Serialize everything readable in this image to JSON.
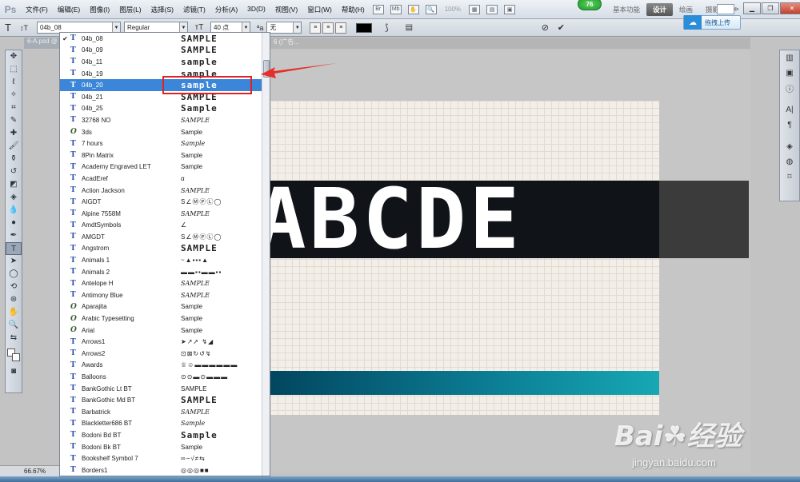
{
  "app": {
    "logo": "Ps",
    "menu": [
      "文件(F)",
      "编辑(E)",
      "图像(I)",
      "图层(L)",
      "选择(S)",
      "滤镜(T)",
      "分析(A)",
      "3D(D)",
      "视图(V)",
      "窗口(W)",
      "帮助(H)"
    ],
    "zoom_display": "100%",
    "badge": "76",
    "workspaces": [
      "基本功能",
      "设计",
      "绘画",
      "摄影"
    ],
    "workspace_more": "≫"
  },
  "options": {
    "font_family": "04b_08",
    "font_style": "Regular",
    "font_size": "40 点",
    "aa_label": "ªa",
    "aa_value": "无",
    "upload_button": "拖拽上传"
  },
  "document": {
    "tab_left": "6-A.psd @",
    "tab_right": "6 (广告...",
    "canvas_text": "ABCDE",
    "zoom_status": "66.67%"
  },
  "font_list": [
    {
      "name": "04b_08",
      "sample": "SAMPLE",
      "type": "tt",
      "checked": true,
      "style": "bold"
    },
    {
      "name": "04b_09",
      "sample": "SAMPLE",
      "type": "tt",
      "style": "bold"
    },
    {
      "name": "04b_11",
      "sample": "sample",
      "type": "tt",
      "style": "bold"
    },
    {
      "name": "04b_19",
      "sample": "sample",
      "type": "tt",
      "style": "bold"
    },
    {
      "name": "04b_20",
      "sample": "sample",
      "type": "tt",
      "selected": true,
      "style": "bold"
    },
    {
      "name": "04b_21",
      "sample": "SAMPLE",
      "type": "tt",
      "style": "bold"
    },
    {
      "name": "04b_25",
      "sample": "Sample",
      "type": "tt",
      "style": "bold"
    },
    {
      "name": "32768 NO",
      "sample": "SAMPLE",
      "type": "tt",
      "style": "script"
    },
    {
      "name": "3ds",
      "sample": "Sample",
      "type": "otf"
    },
    {
      "name": "7 hours",
      "sample": "Sample",
      "type": "tt",
      "style": "script"
    },
    {
      "name": "8Pin Matrix",
      "sample": "Sample",
      "type": "tt"
    },
    {
      "name": "Academy Engraved LET",
      "sample": "Sample",
      "type": "tt"
    },
    {
      "name": "AcadEref",
      "sample": "α",
      "type": "tt"
    },
    {
      "name": "Action Jackson",
      "sample": "SAMPLE",
      "type": "tt",
      "style": "script"
    },
    {
      "name": "AIGDT",
      "sample": "S∠ⓂⓅⓁ◯",
      "type": "tt",
      "style": "sym"
    },
    {
      "name": "Alpine 7558M",
      "sample": "SAMPLE",
      "type": "tt",
      "style": "script"
    },
    {
      "name": "AmdtSymbols",
      "sample": "∠",
      "type": "tt",
      "style": "sym"
    },
    {
      "name": "AMGDT",
      "sample": "S∠ⓂⓅⓁ◯",
      "type": "tt",
      "style": "sym"
    },
    {
      "name": "Angstrom",
      "sample": "SAMPLE",
      "type": "tt",
      "style": "bold"
    },
    {
      "name": "Animals 1",
      "sample": "~▲▪▪▪▲",
      "type": "tt",
      "style": "sym"
    },
    {
      "name": "Animals 2",
      "sample": "▬▬▪▪▬▬▪▪",
      "type": "tt",
      "style": "sym"
    },
    {
      "name": "Antelope H",
      "sample": "SAMPLE",
      "type": "tt",
      "style": "script"
    },
    {
      "name": "Antimony Blue",
      "sample": "SAMPLE",
      "type": "tt",
      "style": "script"
    },
    {
      "name": "Aparajita",
      "sample": "Sample",
      "type": "otf"
    },
    {
      "name": "Arabic Typesetting",
      "sample": "Sample",
      "type": "otf"
    },
    {
      "name": "Arial",
      "sample": "Sample",
      "type": "otf"
    },
    {
      "name": "Arrows1",
      "sample": "➤↗➚ ↯◢",
      "type": "tt",
      "style": "sym"
    },
    {
      "name": "Arrows2",
      "sample": "⊡⊠↻↺↯",
      "type": "tt",
      "style": "sym"
    },
    {
      "name": "Awards",
      "sample": "♕☺▬▬▬▬▬▬",
      "type": "tt",
      "style": "sym"
    },
    {
      "name": "Balloons",
      "sample": "⊙⊙▬⊙▬▬▬",
      "type": "tt",
      "style": "sym"
    },
    {
      "name": "BankGothic Lt BT",
      "sample": "SAMPLE",
      "type": "tt"
    },
    {
      "name": "BankGothic Md BT",
      "sample": "SAMPLE",
      "type": "tt",
      "style": "bold"
    },
    {
      "name": "Barbatrick",
      "sample": "SAMPLE",
      "type": "tt",
      "style": "script"
    },
    {
      "name": "Blackletter686 BT",
      "sample": "Sample",
      "type": "tt",
      "style": "script"
    },
    {
      "name": "Bodoni Bd BT",
      "sample": "Sample",
      "type": "tt",
      "style": "bold"
    },
    {
      "name": "Bodoni Bk BT",
      "sample": "Sample",
      "type": "tt"
    },
    {
      "name": "Bookshelf Symbol 7",
      "sample": "∞−√≠⇆",
      "type": "tt",
      "style": "sym"
    },
    {
      "name": "Borders1",
      "sample": "◎◎◎■■",
      "type": "tt",
      "style": "sym"
    }
  ],
  "watermark": {
    "logo": "Bai☘经验",
    "url": "jingyan.baidu.com"
  }
}
